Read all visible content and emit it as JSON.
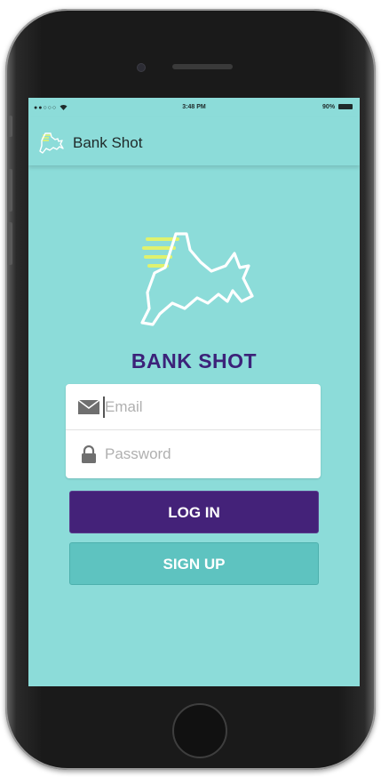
{
  "status_bar": {
    "carrier": "●●○○○ ",
    "time": "3:48 PM",
    "battery": "90%"
  },
  "app_bar": {
    "title": "Bank Shot"
  },
  "brand": {
    "name": "BANK SHOT"
  },
  "login_form": {
    "email_placeholder": "Email",
    "password_placeholder": "Password",
    "login_label": "LOG IN",
    "signup_label": "SIGN UP"
  },
  "icons": {
    "wifi": "wifi-icon",
    "battery": "battery-icon",
    "logo": "rhino-logo",
    "email": "envelope-icon",
    "password": "lock-icon"
  },
  "colors": {
    "background": "#8cdcd9",
    "brand_purple": "#3c2279",
    "login_button": "#442279",
    "signup_button": "#5ec3c0",
    "logo_lines": "#dff26e"
  }
}
